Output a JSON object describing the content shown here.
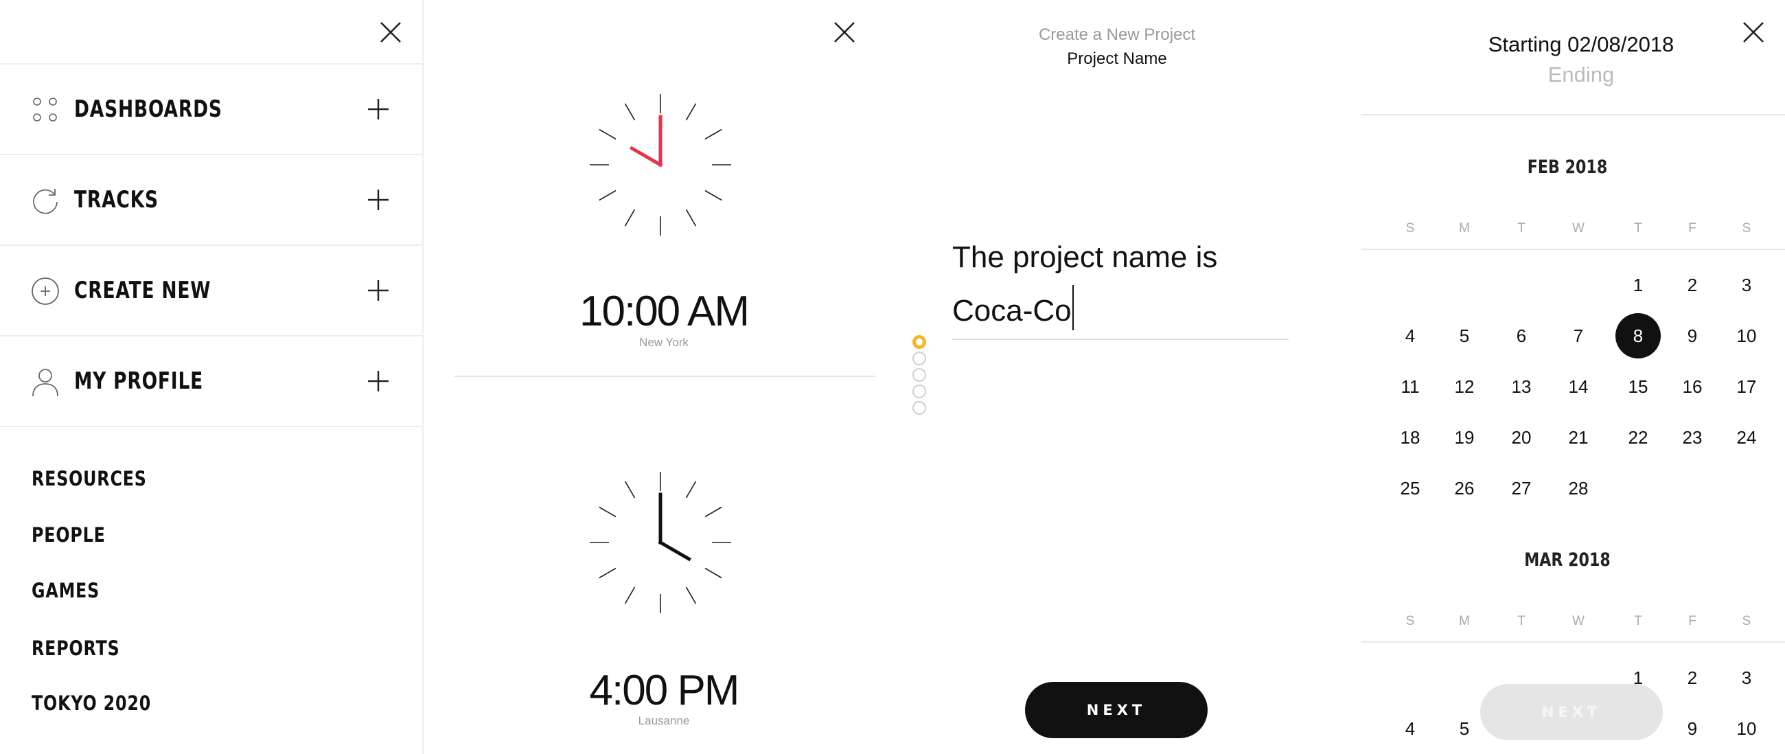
{
  "menu": {
    "items": [
      {
        "label": "DASHBOARDS",
        "icon": "dots-grid-icon"
      },
      {
        "label": "TRACKS",
        "icon": "refresh-circle-icon"
      },
      {
        "label": "CREATE NEW",
        "icon": "plus-circle-icon"
      },
      {
        "label": "MY PROFILE",
        "icon": "user-icon"
      }
    ],
    "links": [
      "RESOURCES",
      "PEOPLE",
      "GAMES",
      "REPORTS",
      "TOKYO 2020"
    ]
  },
  "clocks": [
    {
      "time": "10:00 AM",
      "city": "New York",
      "hand_color": "#e8334a"
    },
    {
      "time": "4:00 PM",
      "city": "Lausanne",
      "hand_color": "#111111"
    }
  ],
  "project": {
    "subtitle": "Create a New Project",
    "title": "Project Name",
    "prompt": "The project name is",
    "value": "Coca-Co",
    "steps_total": 5,
    "step_current": 1,
    "accent_color": "#f4b62e",
    "next_label": "NEXT"
  },
  "calendar": {
    "starting": "Starting 02/08/2018",
    "ending": "Ending",
    "weekdays": [
      "S",
      "M",
      "T",
      "W",
      "T",
      "F",
      "S"
    ],
    "months": [
      {
        "name": "FEB 2018",
        "weeks": [
          [
            "",
            "",
            "",
            "",
            "1",
            "2",
            "3"
          ],
          [
            "4",
            "5",
            "6",
            "7",
            "8",
            "9",
            "10"
          ],
          [
            "11",
            "12",
            "13",
            "14",
            "15",
            "16",
            "17"
          ],
          [
            "18",
            "19",
            "20",
            "21",
            "22",
            "23",
            "24"
          ],
          [
            "25",
            "26",
            "27",
            "28",
            "",
            "",
            ""
          ]
        ]
      },
      {
        "name": "MAR 2018",
        "weeks": [
          [
            "",
            "",
            "",
            "",
            "1",
            "2",
            "3"
          ],
          [
            "4",
            "5",
            "",
            "",
            "",
            "9",
            "10"
          ]
        ]
      }
    ],
    "selected_day": "8",
    "next_label": "NEXT"
  }
}
